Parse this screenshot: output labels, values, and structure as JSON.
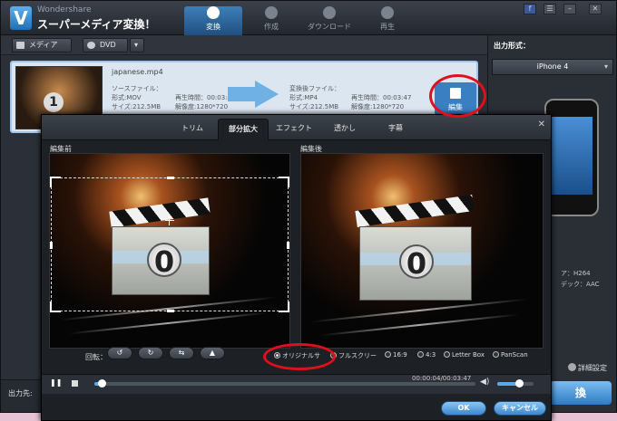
{
  "app": {
    "brand_small": "Wondershare",
    "brand_big": "スーパーメディア変換！",
    "nav_tabs": [
      {
        "label": "変換",
        "active": true
      },
      {
        "label": "作成",
        "active": false
      },
      {
        "label": "ダウンロード",
        "active": false
      },
      {
        "label": "再生",
        "active": false
      }
    ],
    "window_buttons": [
      "f",
      "☰",
      "–",
      "✕"
    ]
  },
  "toolbar": {
    "media_label": "メディア",
    "dvd_label": "DVD",
    "dropdown_caret": "▾"
  },
  "file": {
    "name": "japanese.mp4",
    "source_header": "ソースファイル：",
    "source_format": "形式:MOV",
    "source_size": "サイズ:212.5MB",
    "source_duration": "再生時間：00:03:47",
    "source_resolution": "解像度:1280*720",
    "target_header": "変換後ファイル：",
    "target_format": "形式:MP4",
    "target_size": "サイズ:212.5MB",
    "target_duration": "再生時間：00:03:47",
    "target_resolution": "解像度:1280*720",
    "thumb_number": "1",
    "edit_label": "編集"
  },
  "right_panel": {
    "output_format_label": "出力形式：",
    "device": "iPhone 4",
    "spec_video": "ア：H264",
    "spec_audio": "デック：AAC",
    "advanced_link": "詳細設定",
    "convert_label": "換"
  },
  "bottom": {
    "output_label": "出力先:"
  },
  "dialog": {
    "tabs": [
      {
        "label": "トリム",
        "active": false
      },
      {
        "label": "部分拡大",
        "active": true
      },
      {
        "label": "エフェクト",
        "active": false
      },
      {
        "label": "透かし",
        "active": false
      },
      {
        "label": "字幕",
        "active": false
      }
    ],
    "close_glyph": "✕",
    "before_label": "編集前",
    "after_label": "編集後",
    "zero_glyph": "0",
    "rotate_label": "回転：",
    "rotate_buttons": [
      "↺",
      "↻",
      "⇆",
      "▲"
    ],
    "aspect_options": [
      {
        "label": "オリジナルサ",
        "checked": true
      },
      {
        "label": "フルスクリー",
        "checked": false
      },
      {
        "label": "16:9",
        "checked": false
      },
      {
        "label": "4:3",
        "checked": false
      },
      {
        "label": "Letter Box",
        "checked": false
      },
      {
        "label": "PanScan",
        "checked": false
      }
    ],
    "time_display": "00:00:04/00:03:47",
    "play_glyph": "❚❚",
    "volume_glyph": "◀)",
    "progress_fraction": 0.018,
    "volume_fraction": 0.6,
    "ok_label": "OK",
    "cancel_label": "キャンセル"
  },
  "colors": {
    "accent": "#3a7fc2",
    "highlight": "#e0101a"
  }
}
